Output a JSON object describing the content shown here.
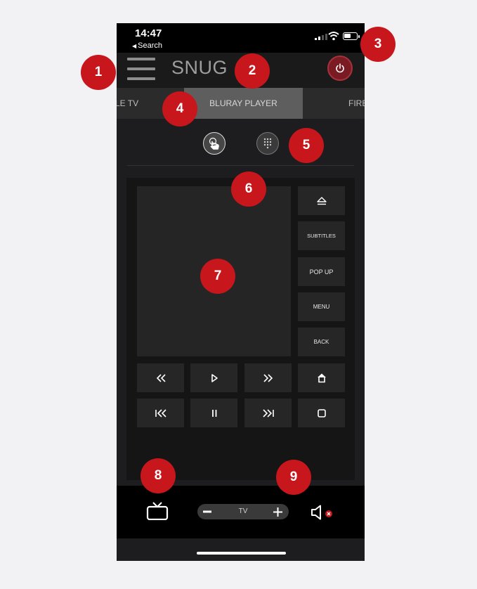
{
  "status_bar": {
    "time": "14:47",
    "back_label": "Search"
  },
  "header": {
    "room_title": "SNUG"
  },
  "tabs": {
    "prev": "LE TV",
    "active": "BLURAY PLAYER",
    "next": "FIRE"
  },
  "side_buttons": {
    "subtitles": "SUBTITLES",
    "pop_up": "POP UP",
    "menu": "MENU",
    "back": "BACK"
  },
  "volume": {
    "label": "TV"
  },
  "callouts": [
    "1",
    "2",
    "3",
    "4",
    "5",
    "6",
    "7",
    "8",
    "9"
  ],
  "colors": {
    "accent_red": "#c8161d",
    "power_red": "#7a1a22",
    "active_tab": "#5e5e5e"
  },
  "icons": [
    "hamburger-icon",
    "power-icon",
    "touch-icon",
    "keypad-icon",
    "eject-icon",
    "rewind-icon",
    "play-icon",
    "fast-forward-icon",
    "home-icon",
    "skip-back-icon",
    "pause-icon",
    "skip-forward-icon",
    "stop-icon",
    "tv-icon",
    "mute-icon"
  ]
}
